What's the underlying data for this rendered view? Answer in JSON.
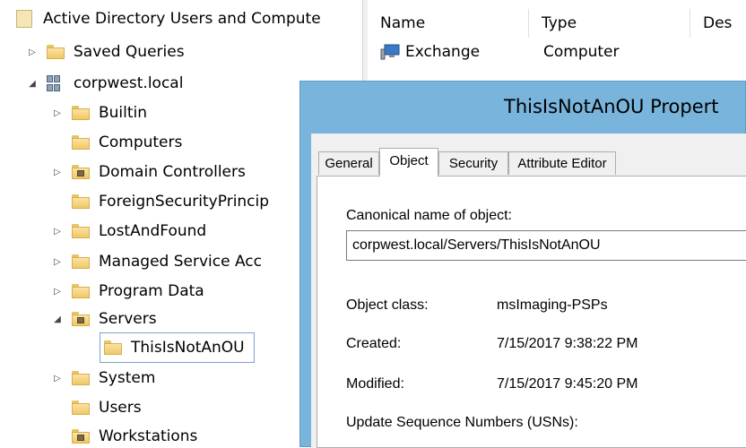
{
  "tree": {
    "root_label": "Active Directory Users and Compute",
    "saved_queries": "Saved Queries",
    "domain": "corpwest.local",
    "children": [
      {
        "label": "Builtin"
      },
      {
        "label": "Computers"
      },
      {
        "label": "Domain Controllers"
      },
      {
        "label": "ForeignSecurityPrincip"
      },
      {
        "label": "LostAndFound"
      },
      {
        "label": "Managed Service Acc"
      },
      {
        "label": "Program Data"
      },
      {
        "label": "Servers"
      },
      {
        "label": "ThisIsNotAnOU"
      },
      {
        "label": "System"
      },
      {
        "label": "Users"
      },
      {
        "label": "Workstations"
      }
    ]
  },
  "list": {
    "columns": [
      "Name",
      "Type",
      "Des"
    ],
    "rows": [
      {
        "name": "Exchange",
        "type": "Computer"
      }
    ]
  },
  "dialog": {
    "title": "ThisIsNotAnOU Propert",
    "tabs": [
      "General",
      "Object",
      "Security",
      "Attribute Editor"
    ],
    "canonical_label": "Canonical name of object:",
    "canonical_value": "corpwest.local/Servers/ThisIsNotAnOU",
    "object_class_label": "Object class:",
    "object_class_value": "msImaging-PSPs",
    "created_label": "Created:",
    "created_value": "7/15/2017 9:38:22 PM",
    "modified_label": "Modified:",
    "modified_value": "7/15/2017 9:45:20 PM",
    "usn_label": "Update Sequence Numbers (USNs):"
  },
  "colors": {
    "title_bar": "#78b4dc",
    "selection_border": "#7da2ce"
  }
}
